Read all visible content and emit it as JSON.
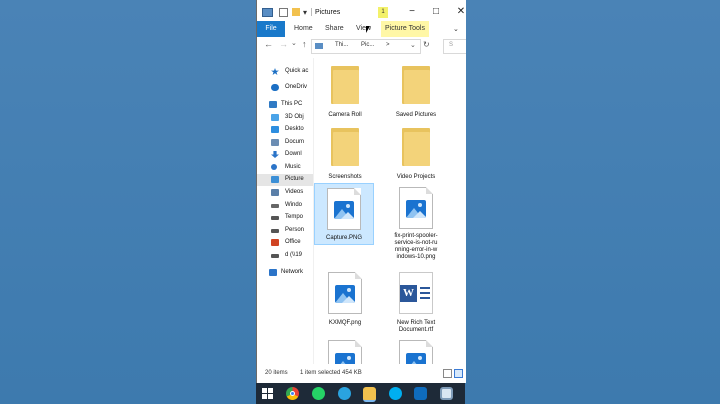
{
  "window": {
    "title": "Pictures",
    "minimize": "−",
    "maximize": "□",
    "close": "✕"
  },
  "ribbon": {
    "tabs": [
      "File",
      "Home",
      "Share",
      "View",
      "Picture Tools"
    ],
    "manage_badge": "1"
  },
  "address": {
    "back": "←",
    "forward": "→",
    "recent": "⌄",
    "up": "↑",
    "path": [
      "Thi...",
      "Pic...",
      ">"
    ],
    "dropdown": "⌄",
    "refresh": "↻",
    "search_placeholder": "S"
  },
  "nav": [
    {
      "label": "Quick ac",
      "icon": "star-icon",
      "color": "#1b6fc4"
    },
    {
      "label": "OneDriv",
      "icon": "cloud-icon",
      "color": "#1b6fc4"
    },
    {
      "label": "This PC",
      "icon": "computer-icon",
      "color": "#2f7ac4"
    },
    {
      "label": "3D Obj",
      "icon": "cube-icon",
      "color": "#4aa3e8"
    },
    {
      "label": "Deskto",
      "icon": "desktop-icon",
      "color": "#2d8ee0"
    },
    {
      "label": "Docum",
      "icon": "document-icon",
      "color": "#6b8db3"
    },
    {
      "label": "Downl",
      "icon": "download-icon",
      "color": "#2b74c8"
    },
    {
      "label": "Music",
      "icon": "music-icon",
      "color": "#2b74c8"
    },
    {
      "label": "Picture",
      "icon": "picture-icon",
      "color": "#3c8fd6"
    },
    {
      "label": "Videos",
      "icon": "video-icon",
      "color": "#5a7fa8"
    },
    {
      "label": "Windo",
      "icon": "drive-icon",
      "color": "#666666"
    },
    {
      "label": "Tempo",
      "icon": "drive-icon",
      "color": "#555555"
    },
    {
      "label": "Person",
      "icon": "drive-icon",
      "color": "#555555"
    },
    {
      "label": "Office",
      "icon": "office-icon",
      "color": "#d04423"
    },
    {
      "label": "d (\\\\19",
      "icon": "network-drive-icon",
      "color": "#555555"
    },
    {
      "label": "Network",
      "icon": "network-icon",
      "color": "#2b74c8"
    }
  ],
  "files": [
    {
      "name": "Camera Roll",
      "type": "folder"
    },
    {
      "name": "Saved Pictures",
      "type": "folder"
    },
    {
      "name": "Screenshots",
      "type": "folder"
    },
    {
      "name": "Video Projects",
      "type": "folder"
    },
    {
      "name": "Capture.PNG",
      "type": "image"
    },
    {
      "name": "fix-print-spooler-service-is-not-running-error-in-windows-10.png",
      "type": "image"
    },
    {
      "name": "KXMQF.png",
      "type": "image"
    },
    {
      "name": "New Rich Text Document.rtf",
      "type": "word"
    }
  ],
  "file_lines": {
    "f5": [
      "fix-print-spooler-",
      "service-is-not-ru",
      "nning-error-in-w",
      "indows-10.png"
    ],
    "f7": [
      "New Rich Text",
      "Document.rtf"
    ]
  },
  "status": {
    "count": "20 items",
    "selection": "1 item selected  454 KB"
  },
  "taskbar": [
    {
      "name": "windows-start-icon",
      "color": "#ffffff"
    },
    {
      "name": "chrome-icon",
      "color": "#e94235"
    },
    {
      "name": "whatsapp-icon",
      "color": "#25d366"
    },
    {
      "name": "telegram-icon",
      "color": "#2aa3df"
    },
    {
      "name": "file-explorer-icon",
      "color": "#f2c14e"
    },
    {
      "name": "skype-icon",
      "color": "#00aff0"
    },
    {
      "name": "outlook-icon",
      "color": "#0f6cbd"
    },
    {
      "name": "taskbar-app-icon",
      "color": "#d9e6f2"
    }
  ]
}
